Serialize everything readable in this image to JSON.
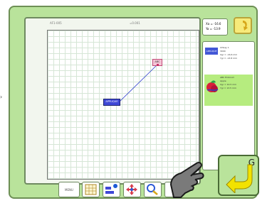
{
  "header": {
    "left": "AF1-005",
    "right": "=0.001"
  },
  "coords": {
    "x": "Xa = -16.6",
    "y": "Ya = -13.9"
  },
  "canvas": {
    "embroidery_a": "APPLIQUE",
    "embroidery_b": "ABC"
  },
  "info": {
    "entry1_thumb": "APPLIQUE",
    "entry1_lines": [
      "Ichbay 1",
      "3000",
      "Xgr = -16.6 mm",
      "Ygr = -13.8 mm"
    ],
    "entry2_lines": [
      "ABC Embroid",
      "Apple",
      "Xgr = 10.5 mm",
      "Ygr = 13.5 mm"
    ]
  },
  "toolbar": {
    "first_label": "MENU"
  },
  "g_button": {
    "label": "G"
  },
  "colors": {
    "background": "#b9e39b",
    "accent_yellow": "#f7ea7a",
    "embroidery_blue": "#3f48d6",
    "embroidery_pink": "#f5c4d6"
  }
}
